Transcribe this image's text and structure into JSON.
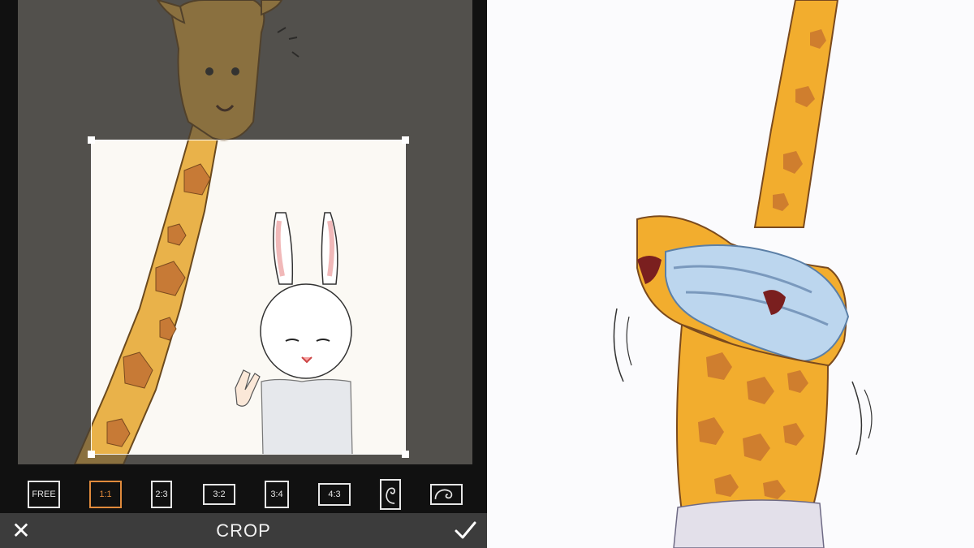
{
  "bottom_bar": {
    "title": "CROP",
    "cancel_symbol": "✕",
    "confirm_icon": "checkmark-icon"
  },
  "ratios": {
    "free": "FREE",
    "r1_1": "1:1",
    "r2_3": "2:3",
    "r3_2": "3:2",
    "r3_4": "3:4",
    "r4_3": "4:3",
    "golden_portrait_icon": "golden-spiral-portrait-icon",
    "golden_landscape_icon": "golden-spiral-landscape-icon",
    "selected": "1:1"
  },
  "colors": {
    "accent": "#e08a3c",
    "bar": "#111111",
    "bottom_bar": "#3c3c3c",
    "photo_bg": "#6d6a66"
  }
}
